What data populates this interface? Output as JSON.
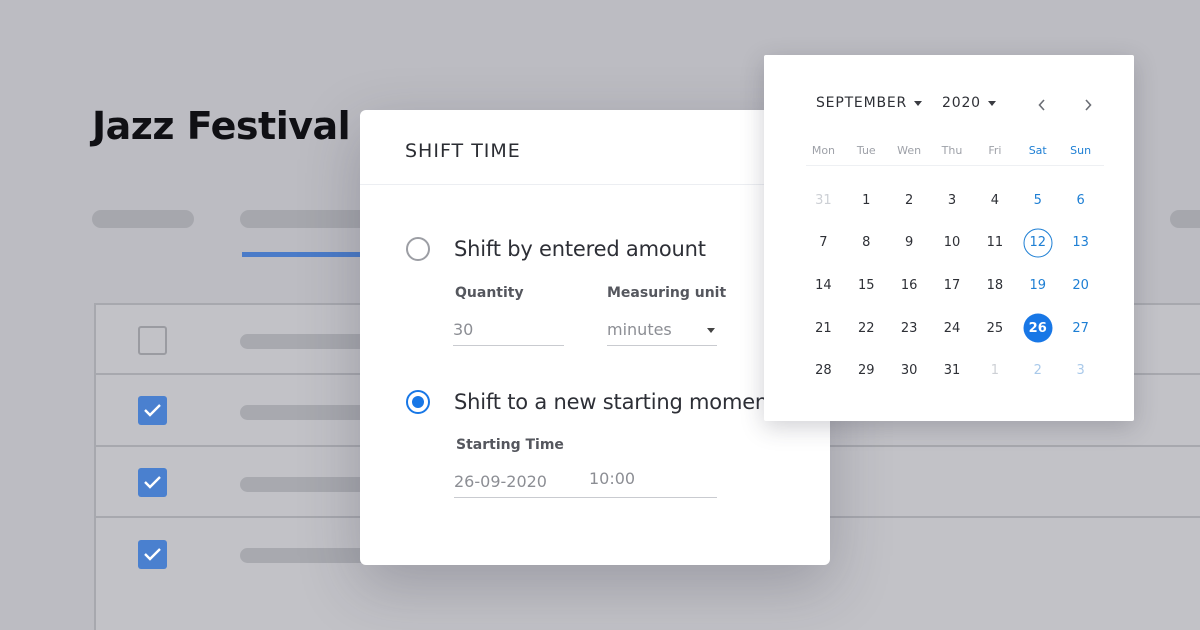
{
  "background": {
    "page_title": "Jazz Festival",
    "rows": [
      {
        "checked": false
      },
      {
        "checked": true
      },
      {
        "checked": true
      },
      {
        "checked": true
      }
    ]
  },
  "dialog": {
    "title": "SHIFT TIME",
    "option_amount": {
      "label": "Shift by entered amount",
      "selected": false,
      "quantity_label": "Quantity",
      "quantity_value": "30",
      "unit_label": "Measuring unit",
      "unit_value": "minutes"
    },
    "option_moment": {
      "label": "Shift to a new starting moment",
      "selected": true,
      "starting_time_label": "Starting Time",
      "date_value": "26-09-2020",
      "time_value": "10:00"
    }
  },
  "calendar": {
    "month": "SEPTEMBER",
    "year": "2020",
    "weekdays": [
      "Mon",
      "Tue",
      "Wen",
      "Thu",
      "Fri",
      "Sat",
      "Sun"
    ],
    "weeks": [
      [
        "31",
        "1",
        "2",
        "3",
        "4",
        "5",
        "6"
      ],
      [
        "7",
        "8",
        "9",
        "10",
        "11",
        "12",
        "13"
      ],
      [
        "14",
        "15",
        "16",
        "17",
        "18",
        "19",
        "20"
      ],
      [
        "21",
        "22",
        "23",
        "24",
        "25",
        "26",
        "27"
      ],
      [
        "28",
        "29",
        "30",
        "31",
        "1",
        "2",
        "3"
      ]
    ],
    "today": "12",
    "selected": "26",
    "accent_color": "#1877e6"
  },
  "icons": {
    "prev": "chevron-left-icon",
    "next": "chevron-right-icon",
    "dropdown": "caret-down-icon",
    "check": "check-icon"
  }
}
